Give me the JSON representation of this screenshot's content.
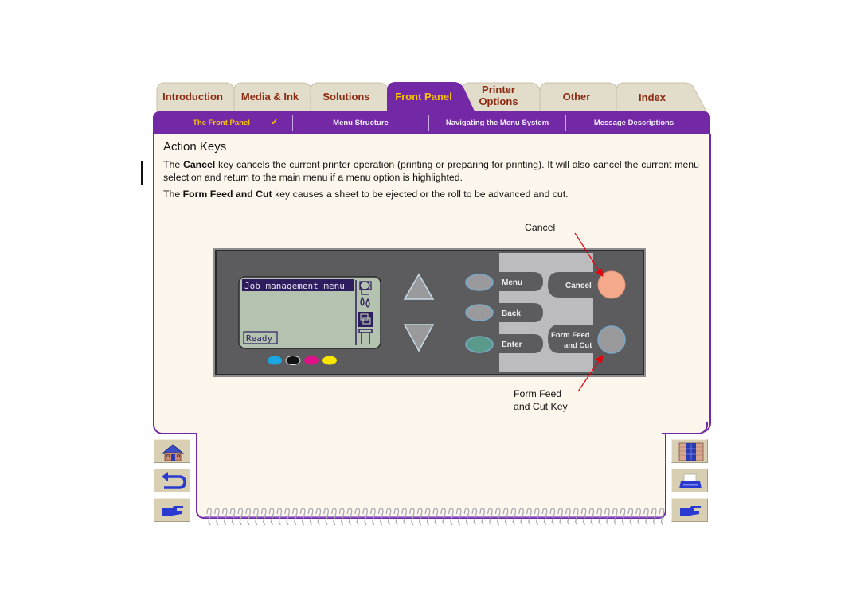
{
  "tabs": [
    {
      "label": "Introduction",
      "active": false
    },
    {
      "label": "Media & Ink",
      "active": false
    },
    {
      "label": "Solutions",
      "active": false
    },
    {
      "label": "Front Panel",
      "active": true
    },
    {
      "label_line1": "Printer",
      "label_line2": "Options",
      "active": false
    },
    {
      "label": "Other",
      "active": false
    },
    {
      "label": "Index",
      "active": false
    }
  ],
  "subnav": [
    {
      "label": "The Front Panel",
      "active": true,
      "checked": true,
      "check_glyph": "✔"
    },
    {
      "label": "Menu Structure",
      "active": false
    },
    {
      "label": "Navigating the Menu System",
      "active": false
    },
    {
      "label": "Message Descriptions",
      "active": false
    }
  ],
  "content": {
    "heading": "Action Keys",
    "para1": {
      "prefix": "The ",
      "bold": "Cancel",
      "suffix": " key cancels the current printer operation (printing or preparing for printing). It will also cancel the current menu selection and return to the main menu if a menu option is highlighted."
    },
    "para2": {
      "prefix": "The ",
      "bold": "Form Feed and Cut",
      "suffix": " key causes a sheet to be ejected or the roll to be advanced and cut."
    },
    "callout_cancel": "Cancel",
    "callout_formfeed_line1": "Form Feed",
    "callout_formfeed_line2": "and Cut Key"
  },
  "front_panel": {
    "lcd_title": "Job management menu",
    "lcd_status": "Ready",
    "lcd_icons": [
      "paper-roll-icon",
      "ink-drops-icon",
      "job-queue-icon",
      "printer-stand-icon"
    ],
    "ink_leds": [
      "#1aa6e0",
      "#111111",
      "#e0128a",
      "#f6e600"
    ],
    "keys": {
      "menu": "Menu",
      "back": "Back",
      "enter": "Enter",
      "cancel": "Cancel",
      "form_feed_line1": "Form Feed",
      "form_feed_line2": "and Cut"
    },
    "colors": {
      "cancel_button": "#f4a98a",
      "enter_button": "#5a9a8a",
      "panel_body": "#5c5c5f",
      "lcd": "#b3c3b0",
      "callout_arrow": "#e8000b"
    }
  },
  "nav": {
    "left": [
      "home-icon",
      "back-icon",
      "next-page-icon"
    ],
    "right": [
      "contents-door-icon",
      "print-icon",
      "previous-page-icon"
    ]
  },
  "theme": {
    "accent": "#7329a6",
    "tab_text": "#8b2a10",
    "active_tab_text": "#f6c400",
    "page_bg": "#fdf6ec"
  }
}
